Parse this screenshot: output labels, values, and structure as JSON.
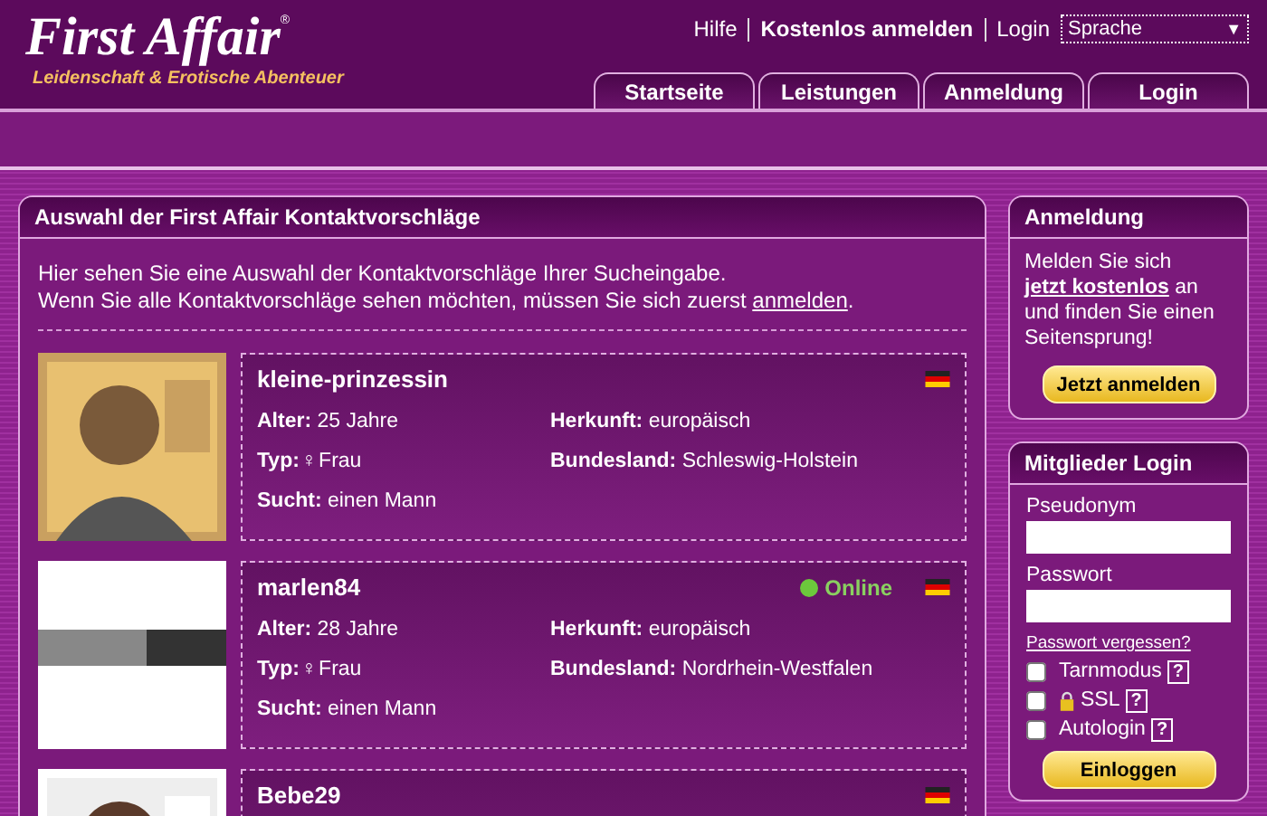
{
  "logo": {
    "title": "First Affair",
    "mark": "®",
    "tagline": "Leidenschaft & Erotische Abenteuer"
  },
  "top_links": [
    "Hilfe",
    "Kostenlos anmelden",
    "Login"
  ],
  "language_select": {
    "value": "Sprache",
    "arrow": "▼"
  },
  "tabs": [
    {
      "label": "Startseite",
      "selected": false
    },
    {
      "label": "Leistungen",
      "selected": false
    },
    {
      "label": "Anmeldung",
      "selected": false
    },
    {
      "label": "Login",
      "selected": false
    }
  ],
  "main": {
    "title": "Auswahl der First Affair Kontaktvorschläge",
    "intro_line_1": "Hier sehen Sie eine Auswahl der Kontaktvorschläge Ihrer Sucheingabe.",
    "intro_line_2": "Wenn Sie alle Kontaktvorschläge sehen möchten, müssen Sie sich zuerst",
    "intro_link": "anmelden",
    "intro_end": ".",
    "profiles": [
      {
        "name": "kleine-prinzessin",
        "online": false,
        "fields": [
          {
            "label": "Alter:",
            "value": "25 Jahre"
          },
          {
            "label": "Herkunft:",
            "value": "europäisch"
          },
          {
            "label": "Typ:",
            "symbol": "♀",
            "value": "Frau"
          },
          {
            "label": "Bundesland:",
            "value": "Schleswig-Holstein"
          },
          {
            "label": "Sucht:",
            "value": "einen Mann"
          }
        ]
      },
      {
        "name": "marlen84",
        "online": true,
        "online_label": "Online",
        "fields": [
          {
            "label": "Alter:",
            "value": "28 Jahre"
          },
          {
            "label": "Herkunft:",
            "value": "europäisch"
          },
          {
            "label": "Typ:",
            "symbol": "♀",
            "value": "Frau"
          },
          {
            "label": "Bundesland:",
            "value": "Nordrhein-Westfalen"
          },
          {
            "label": "Sucht:",
            "value": "einen Mann"
          }
        ]
      },
      {
        "name": "Bebe29",
        "online": false
      }
    ]
  },
  "signup_box": {
    "title": "Anmeldung",
    "text_before": "Melden Sie sich",
    "link": "jetzt kostenlos",
    "text_after": "an und finden Sie einen Seitensprung!",
    "button": "Jetzt anmelden"
  },
  "login_box": {
    "title": "Mitglieder Login",
    "username_label": "Pseudonym",
    "password_label": "Passwort",
    "forgot_link": "Passwort vergessen?",
    "options": [
      {
        "label": "Tarnmodus",
        "checked": false,
        "lock": false,
        "help": "?"
      },
      {
        "label": "SSL",
        "checked": false,
        "lock": true,
        "help": "?"
      },
      {
        "label": "Autologin",
        "checked": false,
        "lock": false,
        "help": "?"
      }
    ],
    "button": "Einloggen"
  }
}
